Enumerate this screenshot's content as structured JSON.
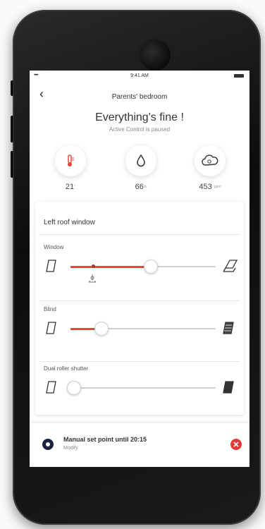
{
  "status_bar": {
    "signal": "•••••",
    "time": "9:41 AM"
  },
  "nav": {
    "back_icon": "chevron-left-icon",
    "title": "Parents' bedroom"
  },
  "headline": "Everything's fine !",
  "subline": "Active Control is paused",
  "metrics": [
    {
      "icon": "thermometer-icon",
      "value": "21",
      "unit": "°"
    },
    {
      "icon": "humidity-drop-icon",
      "value": "66",
      "unit": "%"
    },
    {
      "icon": "co2-cloud-icon",
      "value": "453",
      "unit": "ppm"
    }
  ],
  "device": {
    "title": "Left roof window",
    "sliders": [
      {
        "label": "Window",
        "start_icon": "window-closed-icon",
        "end_icon": "window-open-icon",
        "level": 0.55,
        "setpoint": 0.16
      },
      {
        "label": "Blind",
        "start_icon": "blind-open-icon",
        "end_icon": "blind-closed-icon",
        "level": 0.21
      },
      {
        "label": "Dual roller shutter",
        "start_icon": "shutter-open-icon",
        "end_icon": "shutter-closed-icon",
        "level": 0.02
      }
    ]
  },
  "banner": {
    "title": "Manual set point until 20:15",
    "link": "Modify",
    "icon": "manual-mode-icon",
    "cancel_icon": "close-icon"
  },
  "colors": {
    "accent": "#e8473b",
    "mode_icon": "#1b2340",
    "cancel": "#e53935"
  }
}
